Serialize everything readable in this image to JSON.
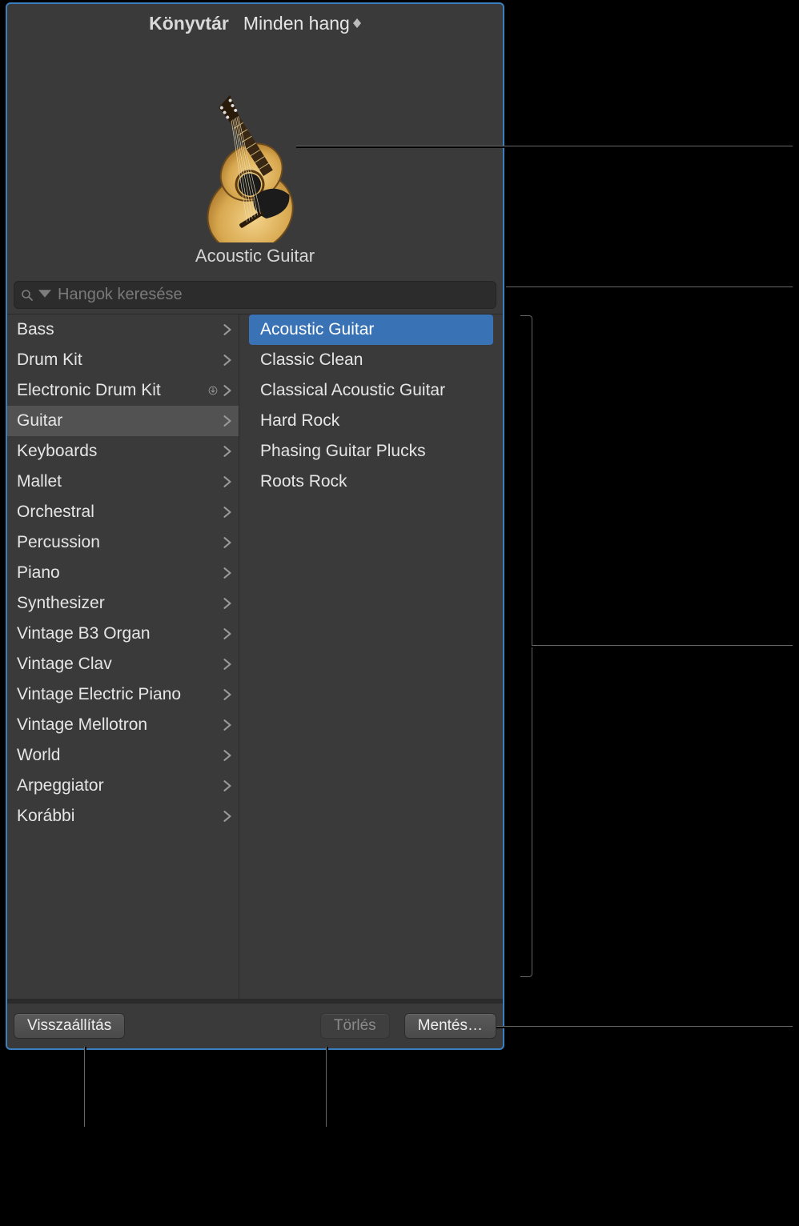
{
  "header": {
    "library_label": "Könyvtár",
    "filter_label": "Minden hang"
  },
  "preview": {
    "instrument_name": "Acoustic Guitar"
  },
  "search": {
    "placeholder": "Hangok keresése"
  },
  "categories": [
    {
      "label": "Bass",
      "has_children": true,
      "downloadable": false,
      "selected": false
    },
    {
      "label": "Drum Kit",
      "has_children": true,
      "downloadable": false,
      "selected": false
    },
    {
      "label": "Electronic Drum Kit",
      "has_children": true,
      "downloadable": true,
      "selected": false
    },
    {
      "label": "Guitar",
      "has_children": true,
      "downloadable": false,
      "selected": true
    },
    {
      "label": "Keyboards",
      "has_children": true,
      "downloadable": false,
      "selected": false
    },
    {
      "label": "Mallet",
      "has_children": true,
      "downloadable": false,
      "selected": false
    },
    {
      "label": "Orchestral",
      "has_children": true,
      "downloadable": false,
      "selected": false
    },
    {
      "label": "Percussion",
      "has_children": true,
      "downloadable": false,
      "selected": false
    },
    {
      "label": "Piano",
      "has_children": true,
      "downloadable": false,
      "selected": false
    },
    {
      "label": "Synthesizer",
      "has_children": true,
      "downloadable": false,
      "selected": false
    },
    {
      "label": "Vintage B3 Organ",
      "has_children": true,
      "downloadable": false,
      "selected": false
    },
    {
      "label": "Vintage Clav",
      "has_children": true,
      "downloadable": false,
      "selected": false
    },
    {
      "label": "Vintage Electric Piano",
      "has_children": true,
      "downloadable": false,
      "selected": false
    },
    {
      "label": "Vintage Mellotron",
      "has_children": true,
      "downloadable": false,
      "selected": false
    },
    {
      "label": "World",
      "has_children": true,
      "downloadable": false,
      "selected": false
    },
    {
      "label": "Arpeggiator",
      "has_children": true,
      "downloadable": false,
      "selected": false
    },
    {
      "label": "Korábbi",
      "has_children": true,
      "downloadable": false,
      "selected": false
    }
  ],
  "presets": [
    {
      "label": "Acoustic Guitar",
      "selected": true
    },
    {
      "label": "Classic Clean",
      "selected": false
    },
    {
      "label": "Classical Acoustic Guitar",
      "selected": false
    },
    {
      "label": "Hard Rock",
      "selected": false
    },
    {
      "label": "Phasing Guitar Plucks",
      "selected": false
    },
    {
      "label": "Roots Rock",
      "selected": false
    }
  ],
  "actions": {
    "revert": "Visszaállítás",
    "delete": "Törlés",
    "save": "Mentés…"
  }
}
